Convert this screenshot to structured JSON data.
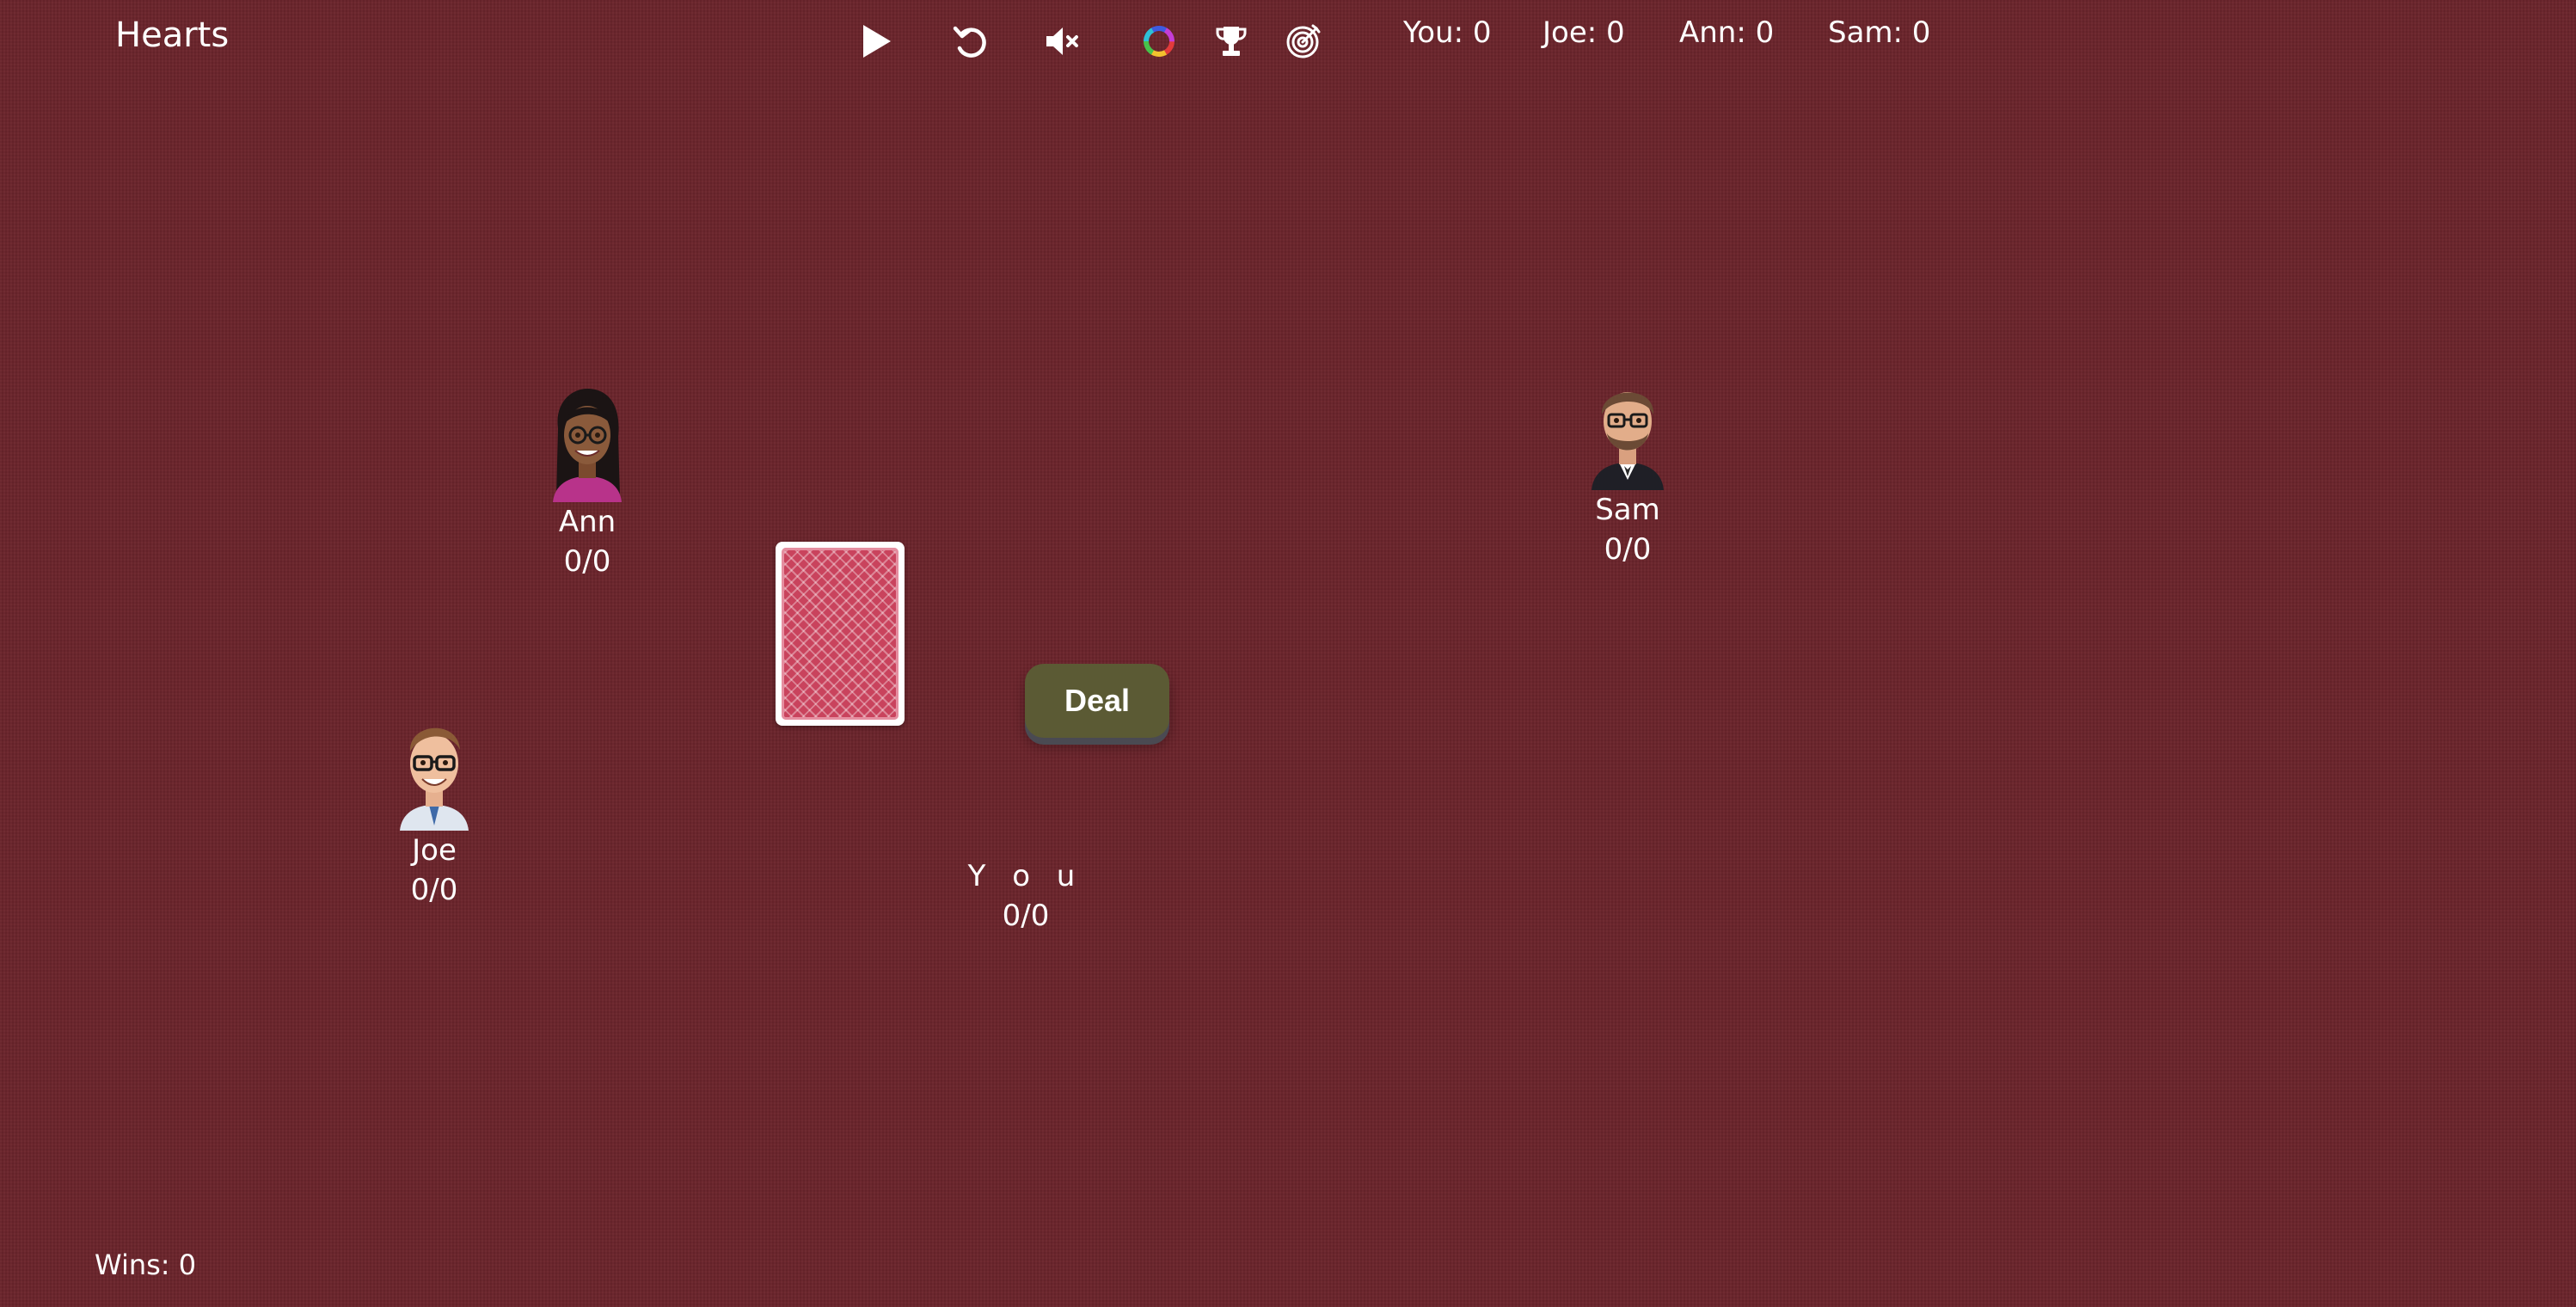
{
  "app": {
    "title": "Hearts"
  },
  "toolbar": {
    "buttons": [
      {
        "name": "play",
        "icon": "play-icon"
      },
      {
        "name": "undo",
        "icon": "undo-icon"
      },
      {
        "name": "sound",
        "icon": "mute-icon"
      },
      {
        "name": "theme",
        "icon": "color-ring-icon"
      },
      {
        "name": "trophy",
        "icon": "trophy-icon"
      },
      {
        "name": "goals",
        "icon": "target-icon"
      }
    ]
  },
  "scoreboard": [
    {
      "label": "You: 0"
    },
    {
      "label": "Joe: 0"
    },
    {
      "label": "Ann: 0"
    },
    {
      "label": "Sam: 0"
    }
  ],
  "players": {
    "ann": {
      "name": "Ann",
      "tricks": "0/0"
    },
    "sam": {
      "name": "Sam",
      "tricks": "0/0"
    },
    "joe": {
      "name": "Joe",
      "tricks": "0/0"
    },
    "you": {
      "name": "Y o u",
      "tricks": "0/0"
    }
  },
  "deal_button": {
    "label": "Deal"
  },
  "footer": {
    "wins": "Wins: 0"
  },
  "colors": {
    "table": "#6b242b",
    "card_back": "#c9435d",
    "deal_button": "#5b5a34"
  }
}
